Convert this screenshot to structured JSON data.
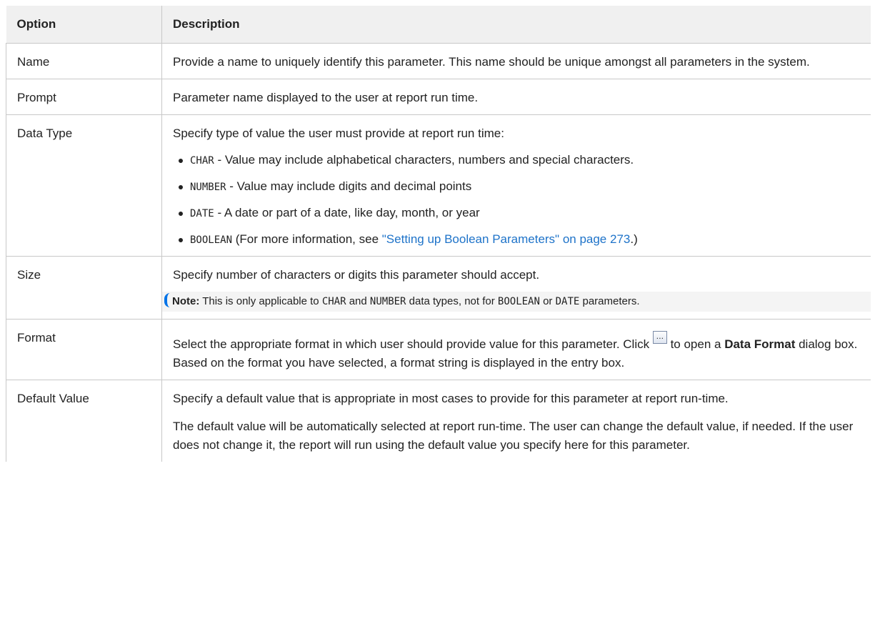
{
  "table": {
    "headers": [
      "Option",
      "Description"
    ],
    "rows": {
      "name": {
        "option": "Name",
        "desc": "Provide a name to uniquely identify this parameter. This name should be unique amongst all parameters in the system."
      },
      "prompt": {
        "option": "Prompt",
        "desc": "Parameter name displayed to the user at report run time."
      },
      "data_type": {
        "option": "Data Type",
        "intro": "Specify type of value the user must provide at report run time:",
        "items": [
          {
            "code": "CHAR",
            "text": " - Value may include alphabetical characters, numbers and special characters."
          },
          {
            "code": "NUMBER",
            "text": " - Value may include digits and decimal points"
          },
          {
            "code": "DATE",
            "text": " - A date or part of a date, like day, month, or year"
          },
          {
            "code": "BOOLEAN",
            "text": " (For more information, see ",
            "link": "\"Setting up Boolean Parameters\" on page 273",
            "after": ".)"
          }
        ]
      },
      "size": {
        "option": "Size",
        "desc": "Specify number of characters or digits this parameter should accept.",
        "note_label": "Note:",
        "note_1": " This is only applicable to ",
        "note_code_1": "CHAR",
        "note_2": " and ",
        "note_code_2": "NUMBER",
        "note_3": " data types, not for ",
        "note_code_3": "BOOLEAN",
        "note_4": " or ",
        "note_code_4": "DATE",
        "note_5": " parameters."
      },
      "format": {
        "option": "Format",
        "desc_1": "Select the appropriate format in which user should provide value for this parameter. Click ",
        "button_label": "...",
        "desc_2": " to open a ",
        "desc_bold": "Data Format",
        "desc_3": " dialog box. Based on the format you have selected, a format string is displayed in the entry box."
      },
      "default_value": {
        "option": "Default Value",
        "desc_1": "Specify a default value that is appropriate in most cases to provide for this parameter at report run-time.",
        "desc_2": "The default value will be automatically selected at report run-time. The user can change the default value, if needed. If the user does not change it, the report will run using the default value you specify here for this parameter."
      }
    }
  }
}
